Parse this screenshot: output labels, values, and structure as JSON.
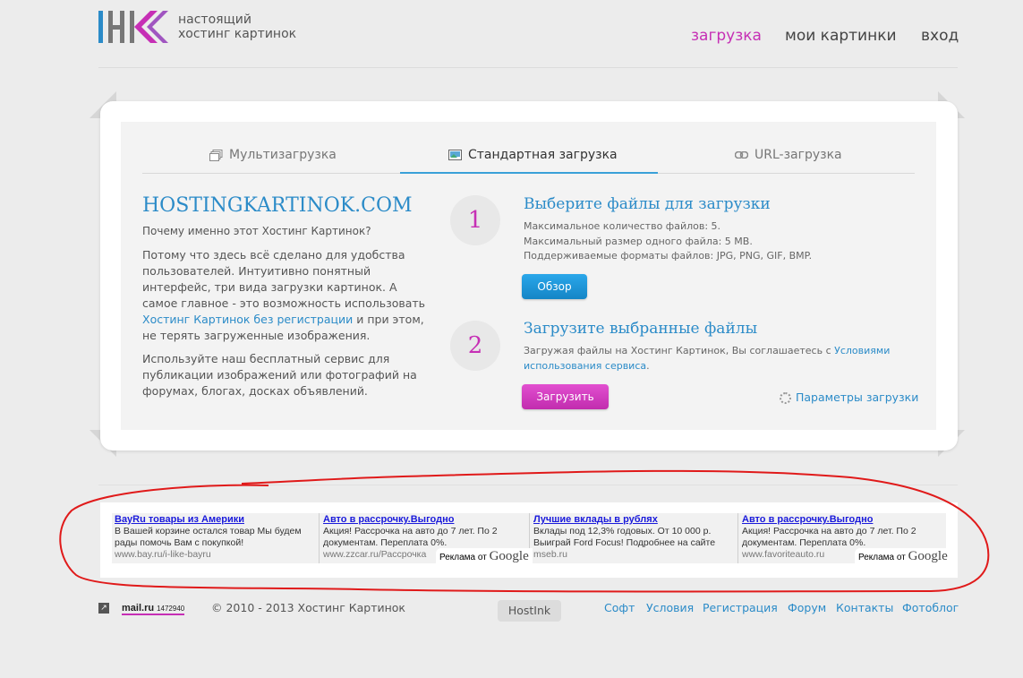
{
  "header": {
    "tagline_line1": "настоящий",
    "tagline_line2": "хостинг картинок",
    "nav": [
      "загрузка",
      "мои картинки",
      "вход"
    ],
    "logo_colors": {
      "blue": "#2b8bc8",
      "gray": "#666666",
      "pink": "#c62fb5"
    }
  },
  "tabs": [
    {
      "label": "Мультизагрузка",
      "icon": "multi-upload-icon"
    },
    {
      "label": "Стандартная загрузка",
      "icon": "image-icon"
    },
    {
      "label": "URL-загрузка",
      "icon": "link-icon"
    }
  ],
  "intro": {
    "title": "HOSTINGKARTINOK.COM",
    "question": "Почему именно этот Хостинг Картинок?",
    "para1_a": "Потому что здесь всё сделано для удобства пользователей. Интуитивно понятный интерфейс, три вида загрузки картинок. А самое главное - это возможность использовать ",
    "para1_link": "Хостинг Картинок без регистрации",
    "para1_b": " и при этом, не терять загруженные изображения.",
    "para2": "Используйте наш бесплатный сервис для публикации изображений или фотографий на форумах, блогах, досках объявлений."
  },
  "step1": {
    "number": "1",
    "title": "Выберите файлы для загрузки",
    "line1": "Максимальное количество файлов: 5.",
    "line2": "Максимальный размер одного файла: 5 MB.",
    "line3": "Поддерживаемые форматы файлов: JPG, PNG, GIF, BMP.",
    "button": "Обзор"
  },
  "step2": {
    "number": "2",
    "title": "Загрузите выбранные файлы",
    "text": "Загружая файлы на Хостинг Картинок, Вы соглашаетесь с ",
    "link": "Условиями использования сервиса",
    "text_end": ".",
    "button": "Загрузить",
    "params": "Параметры загрузки"
  },
  "ads": [
    {
      "title": "BayRu товары из Америки",
      "desc": "В Вашей корзине остался товар Мы будем рады помочь Вам с покупкой!",
      "url": "www.bay.ru/i-like-bayru"
    },
    {
      "title": "Авто в рассрочку.Выгодно",
      "desc": "Акция! Рассрочка на авто до 7 лет. По 2 документам. Переплата 0%.",
      "url": "www.zzcar.ru/Рассрочка"
    },
    {
      "title": "Лучшие вклады в рублях",
      "desc": "Вклады под 12,3% годовых. От 10 000 р. Выиграй Ford Focus! Подробнее на сайте",
      "url": "mseb.ru"
    },
    {
      "title": "Авто в рассрочку.Выгодно",
      "desc": "Акция! Рассрочка на авто до 7 лет. По 2 документам. Переплата 0%.",
      "url": "www.favoriteauto.ru"
    }
  ],
  "adsby": {
    "prefix": "Реклама от",
    "brand": "Google"
  },
  "footer": {
    "counter_brand": "mail.ru",
    "counter_value": "1472940",
    "copyright": "© 2010 - 2013 Хостинг Картинок",
    "hostink": "HostInk",
    "links": [
      "Софт",
      "Условия",
      "Регистрация",
      "Форум",
      "Контакты",
      "Фотоблог"
    ]
  }
}
